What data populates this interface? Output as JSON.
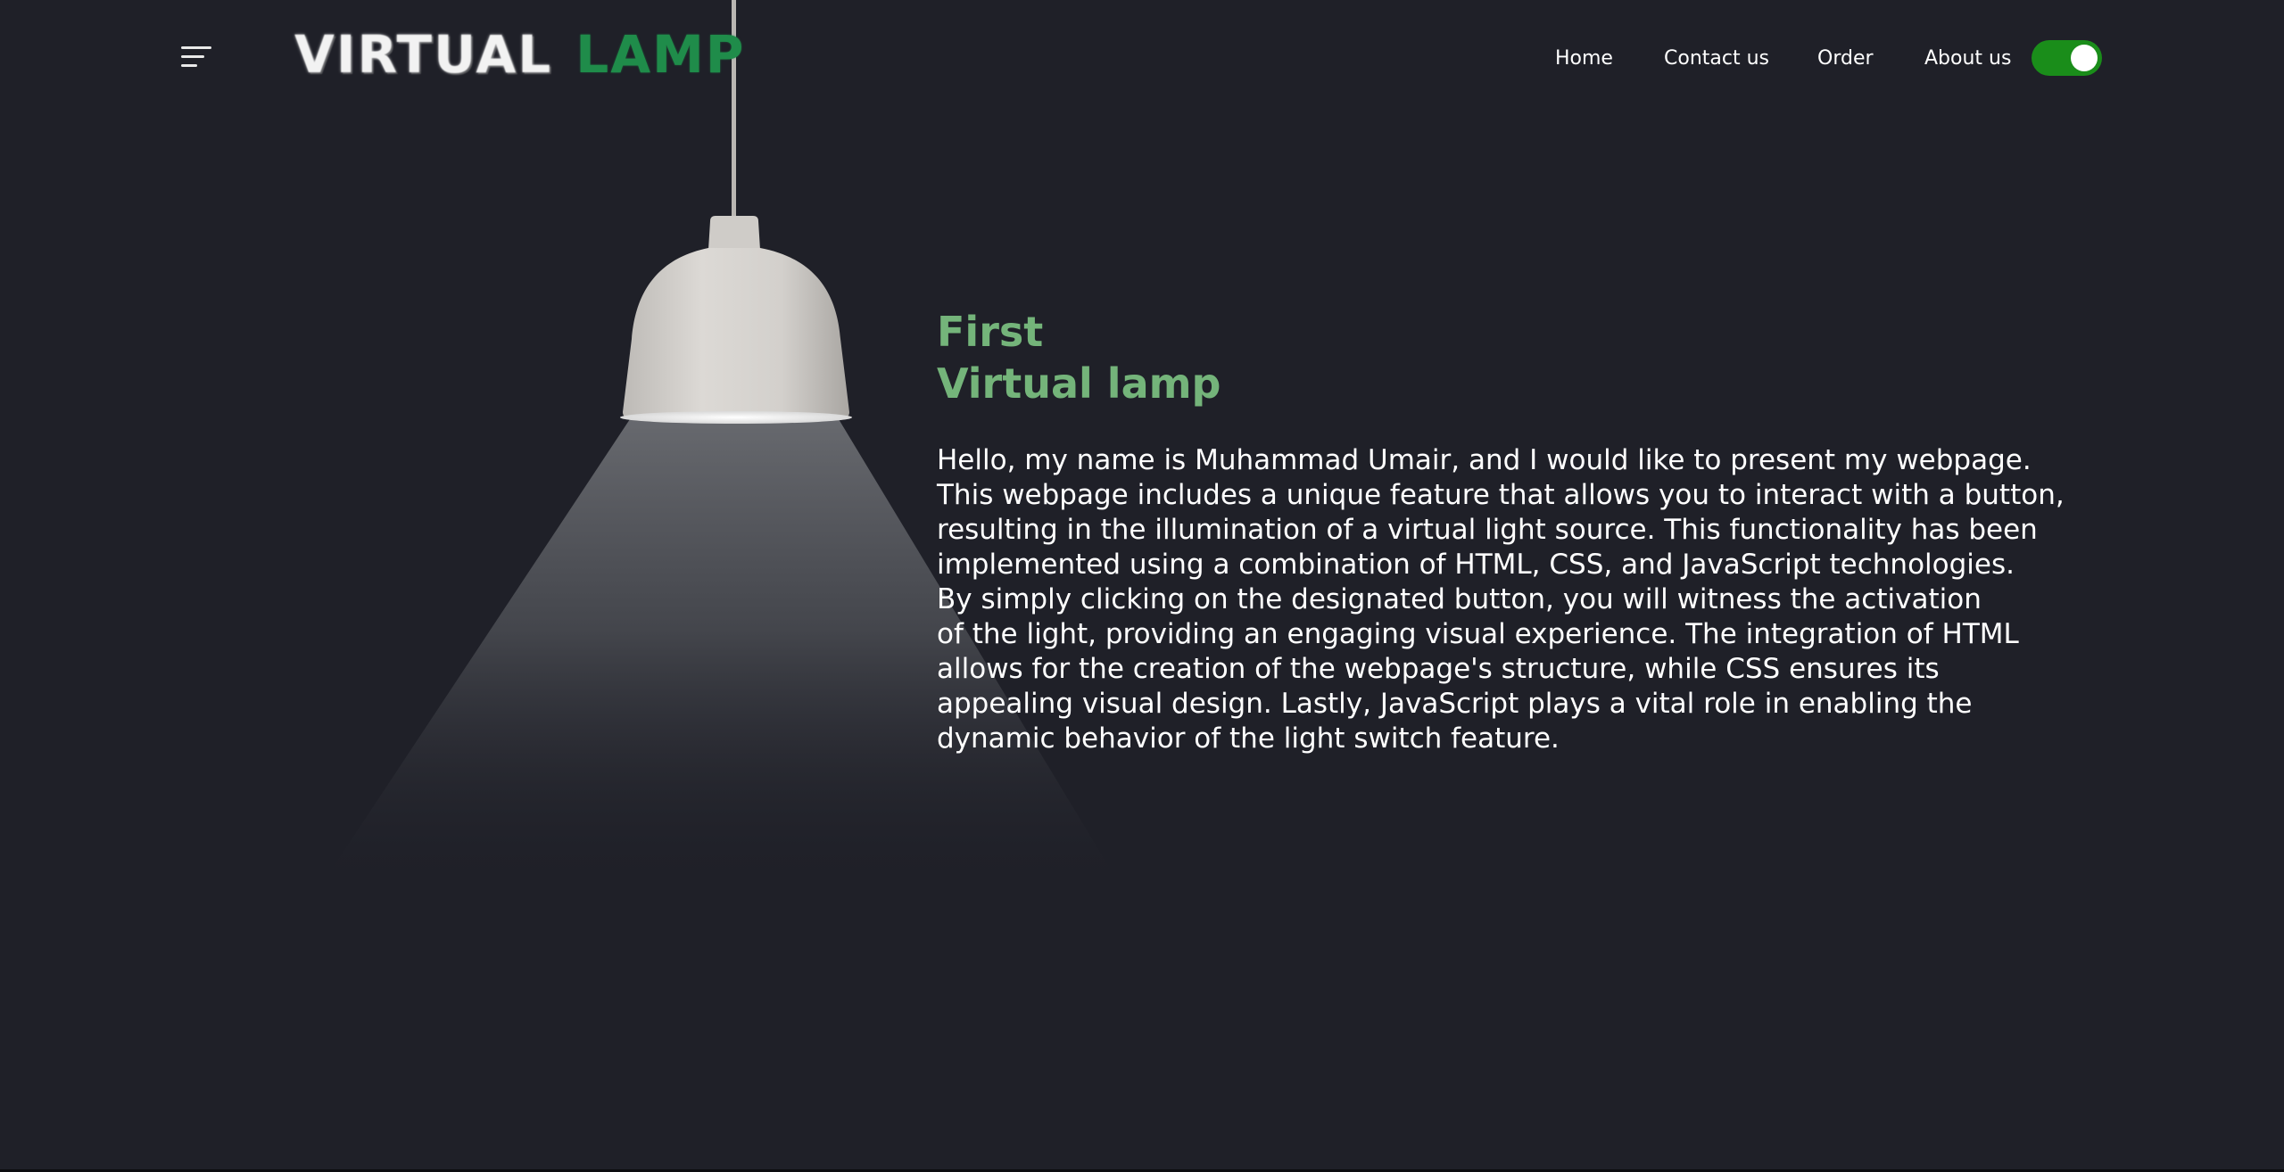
{
  "header": {
    "logo_word_1": "VIRTUAL",
    "logo_word_2": "LAMP",
    "nav": [
      "Home",
      "Contact us",
      "Order",
      "About us"
    ],
    "light_toggle_on": true
  },
  "main": {
    "heading_line_1": "First",
    "heading_line_2": "Virtual lamp",
    "intro_lines": [
      "Hello, my name is Muhammad Umair, and I would like to present my webpage.",
      "This webpage includes a unique feature that allows you to interact with a button,",
      "resulting in the illumination of a virtual light source. This functionality has been",
      "implemented using a combination of HTML, CSS, and JavaScript technologies.",
      "By simply clicking on the designated button, you will witness the activation",
      "of the light, providing an engaging visual experience. The integration of HTML",
      "allows for the creation of the webpage's structure, while CSS ensures its",
      "appealing visual design. Lastly, JavaScript plays a vital role in enabling the",
      "dynamic behavior of the light switch feature."
    ]
  },
  "icons": {
    "menu": "menu-icon",
    "lamp": "pendant-lamp-image"
  },
  "colors": {
    "background": "#1f2028",
    "heading": "#74b47a",
    "logo_accent": "#1f8c4a",
    "toggle_on": "#1a8d1a",
    "text": "#ffffff"
  }
}
